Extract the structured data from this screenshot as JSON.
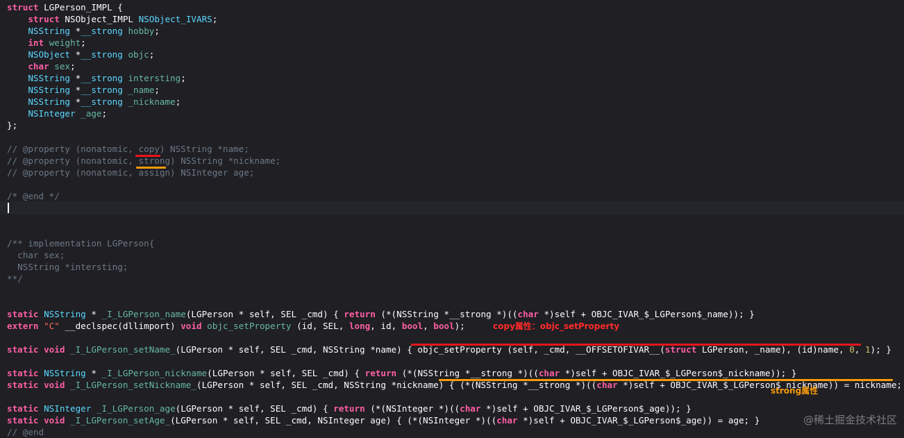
{
  "colors": {
    "background": "#1f1f24",
    "keyword": "#fc5fa3",
    "type": "#5dd8ff",
    "identifier": "#67b7a4",
    "comment": "#6c7986",
    "string": "#fc6a5d",
    "number": "#d0bf69",
    "plain": "#ffffff",
    "copy_underline": "#e8151b",
    "strong_underline": "#f59a0c"
  },
  "lines": [
    [
      [
        "kw",
        "struct "
      ],
      [
        "sname",
        "LGPerson_IMPL"
      ],
      [
        "pl",
        " {"
      ]
    ],
    [
      [
        "pl",
        "    "
      ],
      [
        "kw",
        "struct "
      ],
      [
        "sname",
        "NSObject_IMPL"
      ],
      [
        "type",
        " NSObject_IVARS"
      ],
      [
        "pl",
        ";"
      ]
    ],
    [
      [
        "pl",
        "    "
      ],
      [
        "type",
        "NSString"
      ],
      [
        "pl",
        " *"
      ],
      [
        "type",
        "__strong"
      ],
      [
        "var",
        " hobby"
      ],
      [
        "pl",
        ";"
      ]
    ],
    [
      [
        "pl",
        "    "
      ],
      [
        "kw",
        "int"
      ],
      [
        "var",
        " weight"
      ],
      [
        "pl",
        ";"
      ]
    ],
    [
      [
        "pl",
        "    "
      ],
      [
        "type",
        "NSObject"
      ],
      [
        "pl",
        " *"
      ],
      [
        "type",
        "__strong"
      ],
      [
        "var",
        " objc"
      ],
      [
        "pl",
        ";"
      ]
    ],
    [
      [
        "pl",
        "    "
      ],
      [
        "kw",
        "char"
      ],
      [
        "var",
        " sex"
      ],
      [
        "pl",
        ";"
      ]
    ],
    [
      [
        "pl",
        "    "
      ],
      [
        "type",
        "NSString"
      ],
      [
        "pl",
        " *"
      ],
      [
        "type",
        "__strong"
      ],
      [
        "var",
        " intersting"
      ],
      [
        "pl",
        ";"
      ]
    ],
    [
      [
        "pl",
        "    "
      ],
      [
        "type",
        "NSString"
      ],
      [
        "pl",
        " *"
      ],
      [
        "type",
        "__strong"
      ],
      [
        "var",
        " _name"
      ],
      [
        "pl",
        ";"
      ]
    ],
    [
      [
        "pl",
        "    "
      ],
      [
        "type",
        "NSString"
      ],
      [
        "pl",
        " *"
      ],
      [
        "type",
        "__strong"
      ],
      [
        "var",
        " _nickname"
      ],
      [
        "pl",
        ";"
      ]
    ],
    [
      [
        "pl",
        "    "
      ],
      [
        "type",
        "NSInteger"
      ],
      [
        "var",
        " _age"
      ],
      [
        "pl",
        ";"
      ]
    ],
    [
      [
        "pl",
        "};"
      ]
    ],
    [],
    [
      [
        "com",
        "// @property (nonatomic, copy) NSString *name;"
      ]
    ],
    [
      [
        "com",
        "// @property (nonatomic, strong) NSString *nickname;"
      ]
    ],
    [
      [
        "com",
        "// @property (nonatomic, assign) NSInteger age;"
      ]
    ],
    [],
    [
      [
        "com",
        "/* @end */"
      ]
    ],
    [],
    [],
    [],
    [
      [
        "com",
        "/** implementation LGPerson{"
      ]
    ],
    [
      [
        "com",
        "  char sex;"
      ]
    ],
    [
      [
        "com",
        "  NSString *intersting;"
      ]
    ],
    [
      [
        "com",
        "**/"
      ]
    ],
    [],
    [],
    [
      [
        "kw",
        "static "
      ],
      [
        "type",
        "NSString"
      ],
      [
        "pl",
        " * "
      ],
      [
        "fn",
        "_I_LGPerson_name"
      ],
      [
        "pl",
        "(LGPerson * self, SEL _cmd) { "
      ],
      [
        "kw",
        "return"
      ],
      [
        "pl",
        " (*(NSString *__strong *)(("
      ],
      [
        "kw",
        "char"
      ],
      [
        "pl",
        " *)self + OBJC_IVAR_$_LGPerson$_name)); }"
      ]
    ],
    [
      [
        "kw",
        "extern "
      ],
      [
        "str",
        "\"C\""
      ],
      [
        "pl",
        " __declspec(dllimport) "
      ],
      [
        "kw",
        "void"
      ],
      [
        "pl",
        " "
      ],
      [
        "fn",
        "objc_setProperty"
      ],
      [
        "pl",
        " (id, SEL, "
      ],
      [
        "kw",
        "long"
      ],
      [
        "pl",
        ", id, "
      ],
      [
        "kw",
        "bool"
      ],
      [
        "pl",
        ", "
      ],
      [
        "kw",
        "bool"
      ],
      [
        "pl",
        ");"
      ]
    ],
    [],
    [
      [
        "kw",
        "static void "
      ],
      [
        "fn",
        "_I_LGPerson_setName_"
      ],
      [
        "pl",
        "(LGPerson * self, SEL _cmd, NSString *name) { objc_setProperty (self, _cmd, __OFFSETOFIVAR__("
      ],
      [
        "kw",
        "struct"
      ],
      [
        "pl",
        " LGPerson, _name), (id)name, "
      ],
      [
        "num",
        "0"
      ],
      [
        "pl",
        ", "
      ],
      [
        "num",
        "1"
      ],
      [
        "pl",
        "); }"
      ]
    ],
    [],
    [
      [
        "kw",
        "static "
      ],
      [
        "type",
        "NSString"
      ],
      [
        "pl",
        " * "
      ],
      [
        "fn",
        "_I_LGPerson_nickname"
      ],
      [
        "pl",
        "(LGPerson * self, SEL _cmd) { "
      ],
      [
        "kw",
        "return"
      ],
      [
        "pl",
        " (*(NSString *__strong *)(("
      ],
      [
        "kw",
        "char"
      ],
      [
        "pl",
        " *)self + OBJC_IVAR_$_LGPerson$_nickname)); }"
      ]
    ],
    [
      [
        "kw",
        "static void "
      ],
      [
        "fn",
        "_I_LGPerson_setNickname_"
      ],
      [
        "pl",
        "(LGPerson * self, SEL _cmd, NSString *nickname) { (*(NSString *__strong *)(("
      ],
      [
        "kw",
        "char"
      ],
      [
        "pl",
        " *)self + OBJC_IVAR_$_LGPerson$_nickname)) = nickname; }"
      ]
    ],
    [],
    [
      [
        "kw",
        "static "
      ],
      [
        "type",
        "NSInteger"
      ],
      [
        "pl",
        " "
      ],
      [
        "fn",
        "_I_LGPerson_age"
      ],
      [
        "pl",
        "(LGPerson * self, SEL _cmd) { "
      ],
      [
        "kw",
        "return"
      ],
      [
        "pl",
        " (*(NSInteger *)(("
      ],
      [
        "kw",
        "char"
      ],
      [
        "pl",
        " *)self + OBJC_IVAR_$_LGPerson$_age)); }"
      ]
    ],
    [
      [
        "kw",
        "static void "
      ],
      [
        "fn",
        "_I_LGPerson_setAge_"
      ],
      [
        "pl",
        "(LGPerson * self, SEL _cmd, NSInteger age) { (*(NSInteger *)(("
      ],
      [
        "kw",
        "char"
      ],
      [
        "pl",
        " *)self + OBJC_IVAR_$_LGPerson$_age)) = age; }"
      ]
    ],
    [
      [
        "com",
        "// @end"
      ]
    ]
  ],
  "annotations": {
    "copy": "copy属性：objc_setProperty",
    "strong": "strong属性"
  },
  "watermark": "@稀土掘金技术社区"
}
